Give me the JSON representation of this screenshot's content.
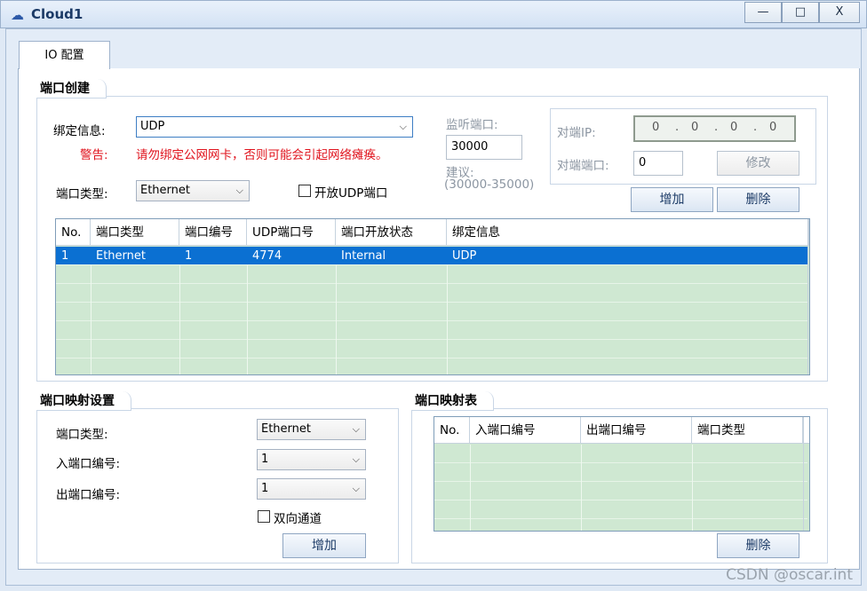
{
  "window": {
    "title": "Cloud1",
    "min": "—",
    "max": "□",
    "close": "X"
  },
  "tab": {
    "label": "IO 配置"
  },
  "port_create": {
    "title": "端口创建",
    "bind_label": "绑定信息:",
    "bind_value": "UDP",
    "warning_label": "警告:",
    "warning_text": "请勿绑定公网网卡，否则可能会引起网络瘫痪。",
    "port_type_label": "端口类型:",
    "port_type_value": "Ethernet",
    "open_udp_label": "开放UDP端口",
    "listen_label": "监听端口:",
    "listen_value": "30000",
    "suggest_label": "建议:",
    "suggest_range": "(30000-35000)",
    "peer_ip_label": "对端IP:",
    "peer_ip_value": [
      "0",
      "0",
      "0",
      "0"
    ],
    "peer_port_label": "对端端口:",
    "peer_port_value": "0",
    "modify_button": "修改",
    "add_button": "增加",
    "delete_button": "删除"
  },
  "port_table": {
    "headers": [
      "No.",
      "端口类型",
      "端口编号",
      "UDP端口号",
      "端口开放状态",
      "绑定信息"
    ],
    "rows": [
      [
        "1",
        "Ethernet",
        "1",
        "4774",
        "Internal",
        "UDP"
      ]
    ]
  },
  "mapping_settings": {
    "title": "端口映射设置",
    "port_type_label": "端口类型:",
    "port_type_value": "Ethernet",
    "in_port_label": "入端口编号:",
    "in_port_value": "1",
    "out_port_label": "出端口编号:",
    "out_port_value": "1",
    "bidirectional_label": "双向通道",
    "add_button": "增加"
  },
  "mapping_table": {
    "title": "端口映射表",
    "headers": [
      "No.",
      "入端口编号",
      "出端口编号",
      "端口类型"
    ],
    "delete_button": "删除"
  },
  "watermark": "CSDN @oscar.int"
}
